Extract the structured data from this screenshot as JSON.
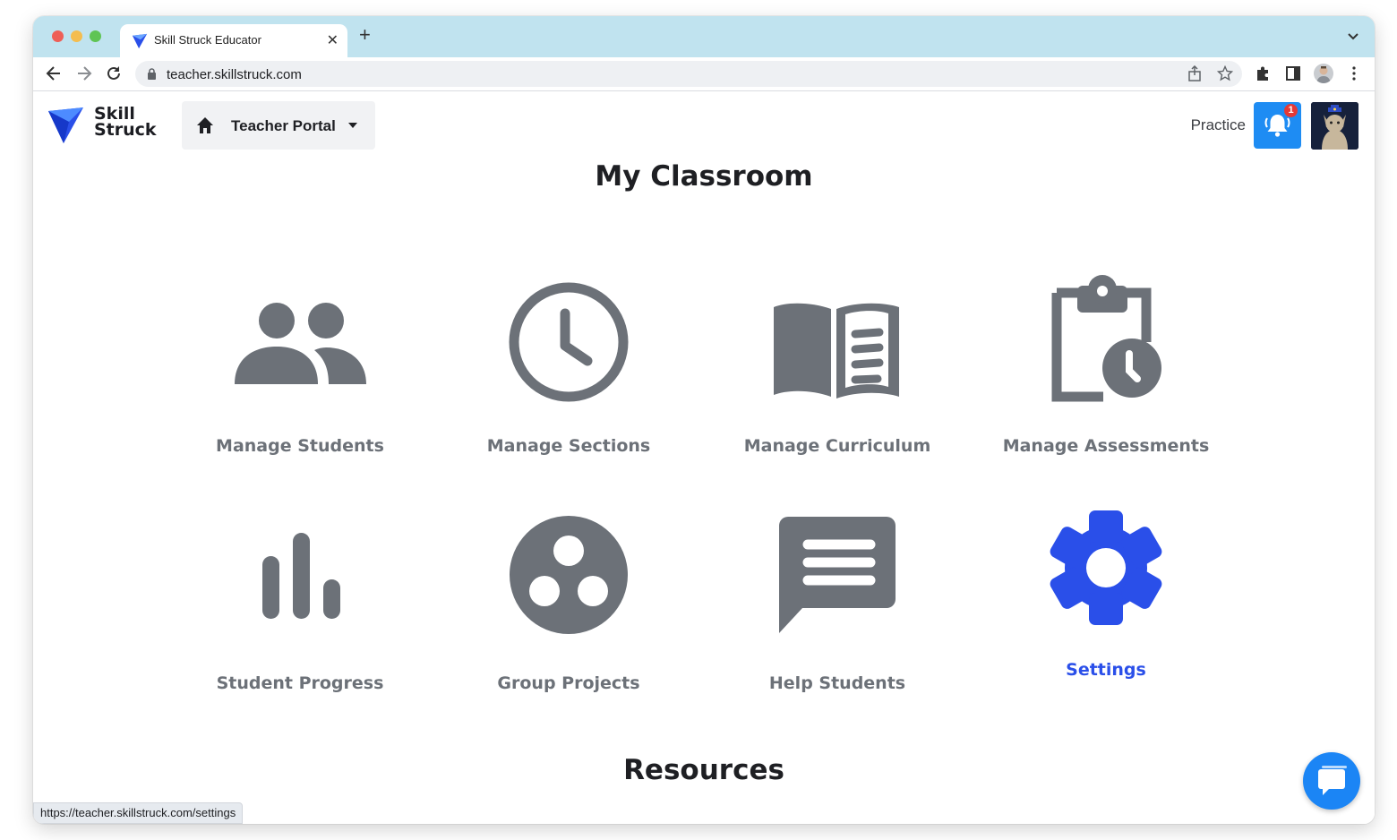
{
  "browser": {
    "tab_title": "Skill Struck Educator",
    "url": "teacher.skillstruck.com",
    "status_url": "https://teacher.skillstruck.com/settings"
  },
  "header": {
    "logo_line1": "Skill",
    "logo_line2": "Struck",
    "portal_label": "Teacher Portal",
    "practice_label": "Practice",
    "notification_count": "1"
  },
  "main": {
    "title": "My Classroom",
    "cards": [
      {
        "label": "Manage Students",
        "icon": "people-icon"
      },
      {
        "label": "Manage Sections",
        "icon": "clock-icon"
      },
      {
        "label": "Manage Curriculum",
        "icon": "book-icon"
      },
      {
        "label": "Manage Assessments",
        "icon": "clipboard-clock-icon"
      },
      {
        "label": "Student Progress",
        "icon": "bar-chart-icon"
      },
      {
        "label": "Group Projects",
        "icon": "group-circles-icon"
      },
      {
        "label": "Help Students",
        "icon": "message-icon"
      },
      {
        "label": "Settings",
        "icon": "gear-icon",
        "active": true
      }
    ],
    "resources_title": "Resources"
  },
  "colors": {
    "icon_gray": "#6c7178",
    "active_blue": "#2a4fe9",
    "brand_blue": "#1e8cf3",
    "tab_strip": "#c0e3ef"
  }
}
